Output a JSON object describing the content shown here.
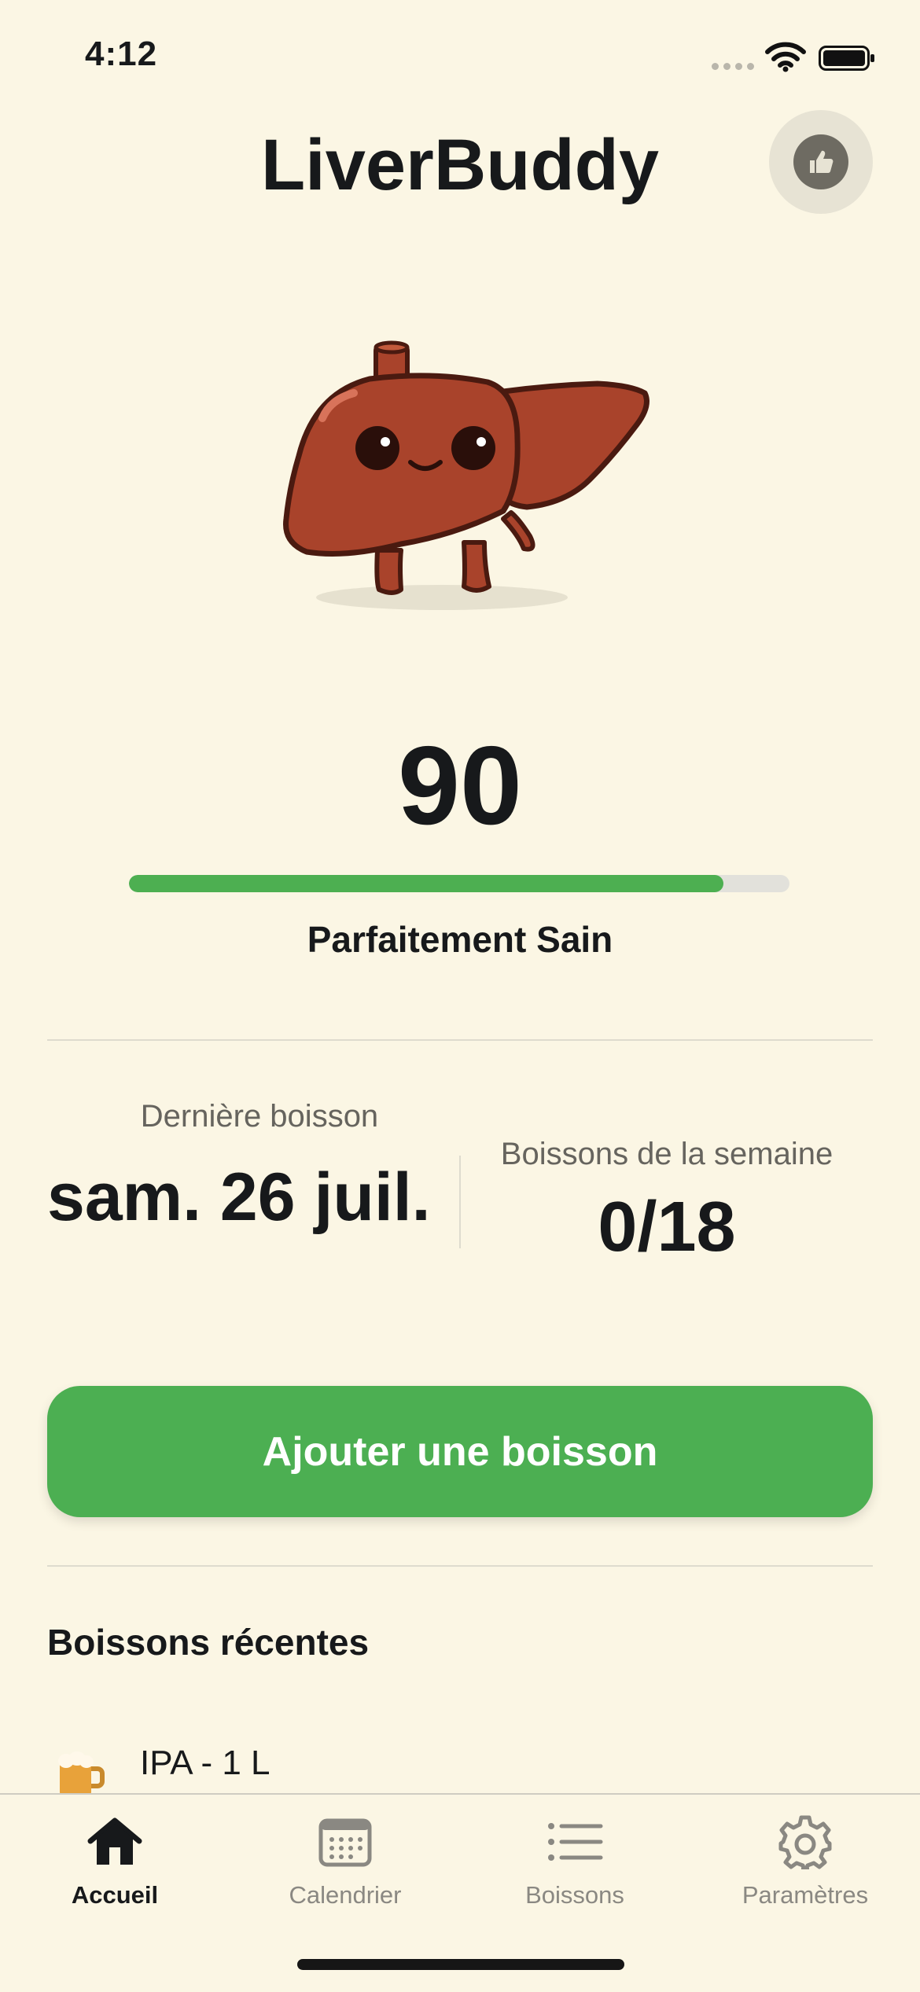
{
  "status_bar": {
    "time": "4:12"
  },
  "header": {
    "title": "LiverBuddy",
    "action_icon": "thumbs-up-icon"
  },
  "health": {
    "score": "90",
    "progress": 0.9,
    "status": "Parfaitement Sain"
  },
  "stats": {
    "last_drink_label": "Dernière boisson",
    "last_drink_value": "sam. 26 juil.",
    "week_label": "Boissons de la semaine",
    "week_value": "0/18"
  },
  "add_button": {
    "label": "Ajouter une boisson"
  },
  "recent": {
    "title": "Boissons récentes",
    "items": [
      {
        "icon": "beer-mug-icon",
        "label": "IPA - 1 L"
      }
    ]
  },
  "tabs": [
    {
      "label": "Accueil",
      "icon": "home-icon",
      "active": true
    },
    {
      "label": "Calendrier",
      "icon": "calendar-icon",
      "active": false
    },
    {
      "label": "Boissons",
      "icon": "list-icon",
      "active": false
    },
    {
      "label": "Paramètres",
      "icon": "gear-icon",
      "active": false
    }
  ],
  "colors": {
    "background": "#fbf6e4",
    "accent": "#4caf52",
    "liver": "#a9432b"
  }
}
